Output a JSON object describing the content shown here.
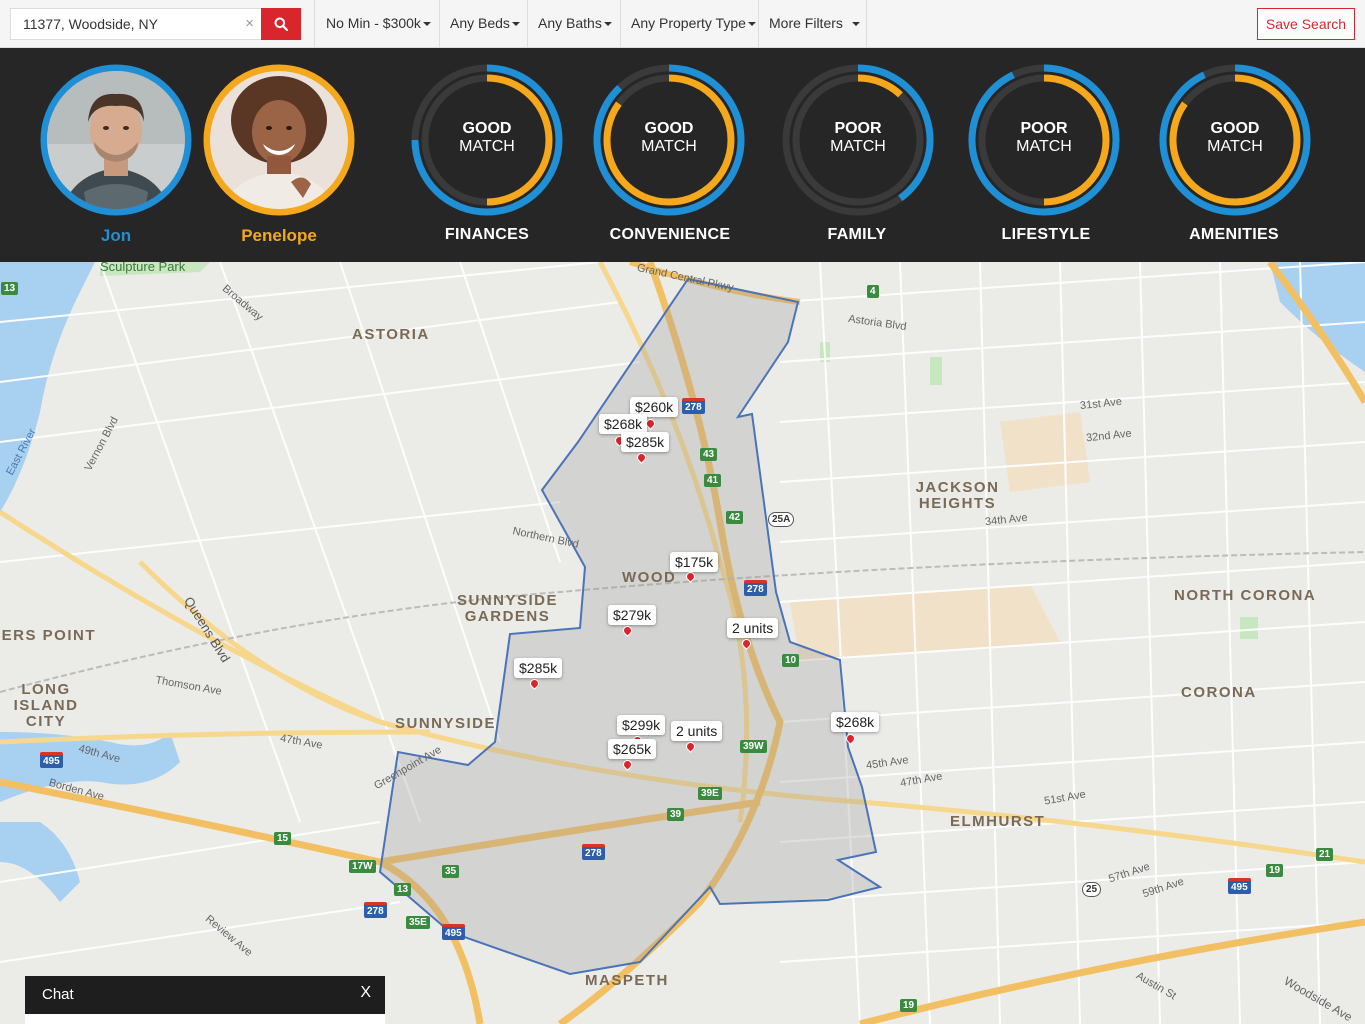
{
  "search": {
    "value": "11377, Woodside, NY",
    "clear_icon": "×"
  },
  "filters": {
    "price": "No Min - $300k",
    "beds": "Any Beds",
    "baths": "Any Baths",
    "property_type": "Any Property Type",
    "more": "More Filters"
  },
  "save_label": "Save Search",
  "people": [
    {
      "name": "Jon",
      "color": "#1f8fd6"
    },
    {
      "name": "Penelope",
      "color": "#f5a81c"
    }
  ],
  "colors": {
    "person_a": "#1f8fd6",
    "person_b": "#f5a81c",
    "accent_red": "#d9262c"
  },
  "matches": [
    {
      "category": "FINANCES",
      "rating": "GOOD",
      "word": "MATCH",
      "person_a_level": 0.75,
      "person_b_level": 0.5
    },
    {
      "category": "CONVENIENCE",
      "rating": "GOOD",
      "word": "MATCH",
      "person_a_level": 0.88,
      "person_b_level": 0.85
    },
    {
      "category": "FAMILY",
      "rating": "POOR",
      "word": "MATCH",
      "person_a_level": 0.4,
      "person_b_level": 0.12
    },
    {
      "category": "LIFESTYLE",
      "rating": "POOR",
      "word": "MATCH",
      "person_a_level": 0.93,
      "person_b_level": 0.5
    },
    {
      "category": "AMENITIES",
      "rating": "GOOD",
      "word": "MATCH",
      "person_a_level": 0.93,
      "person_b_level": 0.85
    }
  ],
  "map": {
    "areas": [
      "ASTORIA",
      "JACKSON HEIGHTS",
      "NORTH CORONA",
      "CORONA",
      "ELMHURST",
      "SUNNYSIDE GARDENS",
      "SUNNYSIDE",
      "WOODSIDE",
      "LONG ISLAND CITY",
      "MASPETH",
      "HUNTERS POINT"
    ],
    "streets": [
      "Sculpture Park",
      "Broadway",
      "Astoria Blvd",
      "Grand Central Pkwy",
      "31st Ave",
      "32nd Ave",
      "34th Ave",
      "Northern Blvd",
      "Queens Blvd",
      "Thomson Ave",
      "47th Ave",
      "49th Ave",
      "Borden Ave",
      "Greenpoint Ave",
      "Review Ave",
      "45th Ave",
      "47th Ave",
      "51st Ave",
      "57th Ave",
      "59th Ave",
      "Woodside Ave",
      "Austin St",
      "East River",
      "Vernon Blvd"
    ],
    "listings": [
      {
        "price": "$260k"
      },
      {
        "price": "$268k"
      },
      {
        "price": "$285k"
      },
      {
        "price": "$175k"
      },
      {
        "price": "$279k"
      },
      {
        "price": "2 units"
      },
      {
        "price": "$285k"
      },
      {
        "price": "$299k"
      },
      {
        "price": "$265k"
      },
      {
        "price": "2 units"
      },
      {
        "price": "$268k"
      }
    ],
    "shields": [
      "278",
      "43",
      "41",
      "42",
      "25A",
      "278",
      "10",
      "39W",
      "39E",
      "39",
      "278",
      "35",
      "17W",
      "13",
      "35E",
      "495",
      "278",
      "495",
      "15",
      "4",
      "13",
      "21",
      "19",
      "495",
      "25",
      "19"
    ]
  },
  "chat": {
    "title": "Chat",
    "close": "X"
  }
}
